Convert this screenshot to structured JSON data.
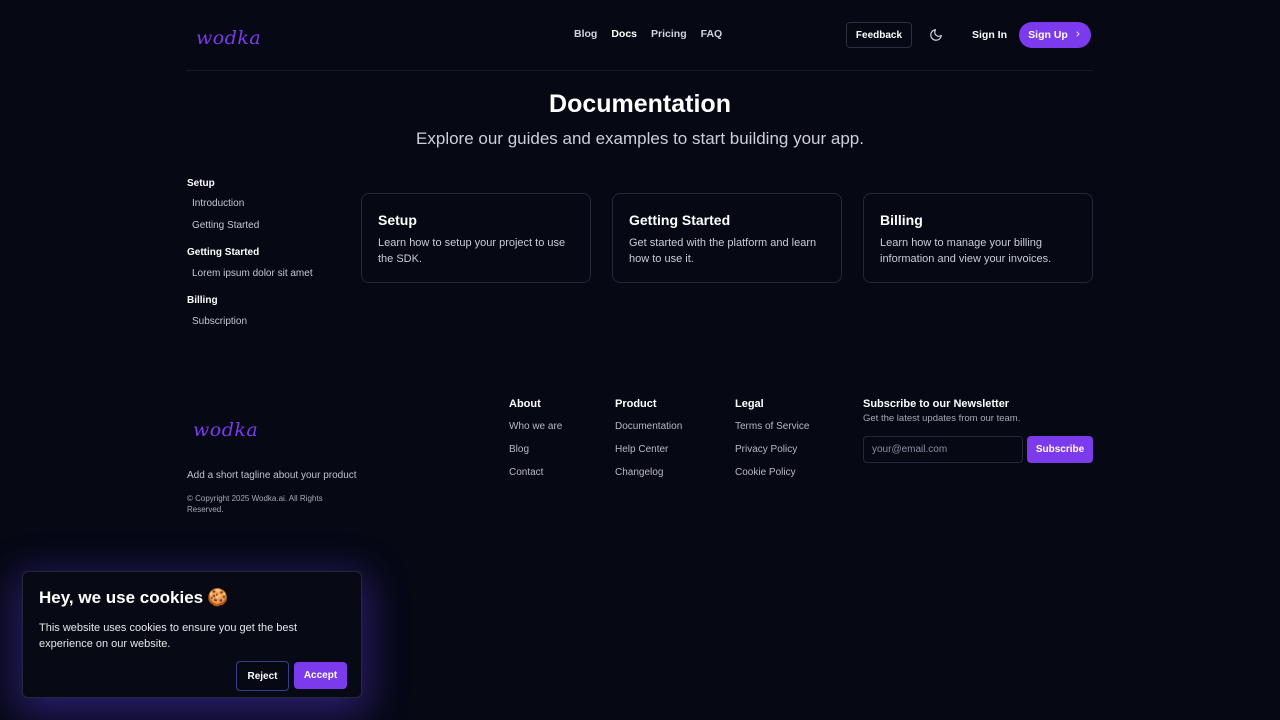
{
  "brand": {
    "logo_text": "wodka",
    "accent_color": "#7c3aed"
  },
  "header": {
    "nav": [
      {
        "label": "Blog"
      },
      {
        "label": "Docs",
        "active": true
      },
      {
        "label": "Pricing"
      },
      {
        "label": "FAQ"
      }
    ],
    "feedback_label": "Feedback",
    "theme_icon": "moon-icon",
    "signin_label": "Sign In",
    "signup_label": "Sign Up",
    "signup_icon": "chevron-right-icon"
  },
  "hero": {
    "title": "Documentation",
    "subtitle": "Explore our guides and examples to start building your app."
  },
  "sidebar": {
    "groups": [
      {
        "heading": "Setup",
        "items": [
          "Introduction",
          "Getting Started"
        ]
      },
      {
        "heading": "Getting Started",
        "items": [
          "Lorem ipsum dolor sit amet"
        ]
      },
      {
        "heading": "Billing",
        "items": [
          "Subscription"
        ]
      }
    ]
  },
  "cards": [
    {
      "title": "Setup",
      "text": "Learn how to setup your project to use the SDK."
    },
    {
      "title": "Getting Started",
      "text": "Get started with the platform and learn how to use it."
    },
    {
      "title": "Billing",
      "text": "Learn how to manage your billing information and view your invoices."
    }
  ],
  "footer": {
    "tagline": "Add a short tagline about your product",
    "copyright": "© Copyright 2025 Wodka.ai. All Rights Reserved.",
    "columns": [
      {
        "heading": "About",
        "links": [
          "Who we are",
          "Blog",
          "Contact"
        ]
      },
      {
        "heading": "Product",
        "links": [
          "Documentation",
          "Help Center",
          "Changelog"
        ]
      },
      {
        "heading": "Legal",
        "links": [
          "Terms of Service",
          "Privacy Policy",
          "Cookie Policy"
        ]
      }
    ],
    "newsletter": {
      "heading": "Subscribe to our Newsletter",
      "text": "Get the latest updates from our team.",
      "placeholder": "your@email.com",
      "button_label": "Subscribe"
    }
  },
  "cookie_banner": {
    "title": "Hey, we use cookies",
    "emoji": "🍪",
    "text": "This website uses cookies to ensure you get the best experience on our website.",
    "reject_label": "Reject",
    "accept_label": "Accept"
  }
}
